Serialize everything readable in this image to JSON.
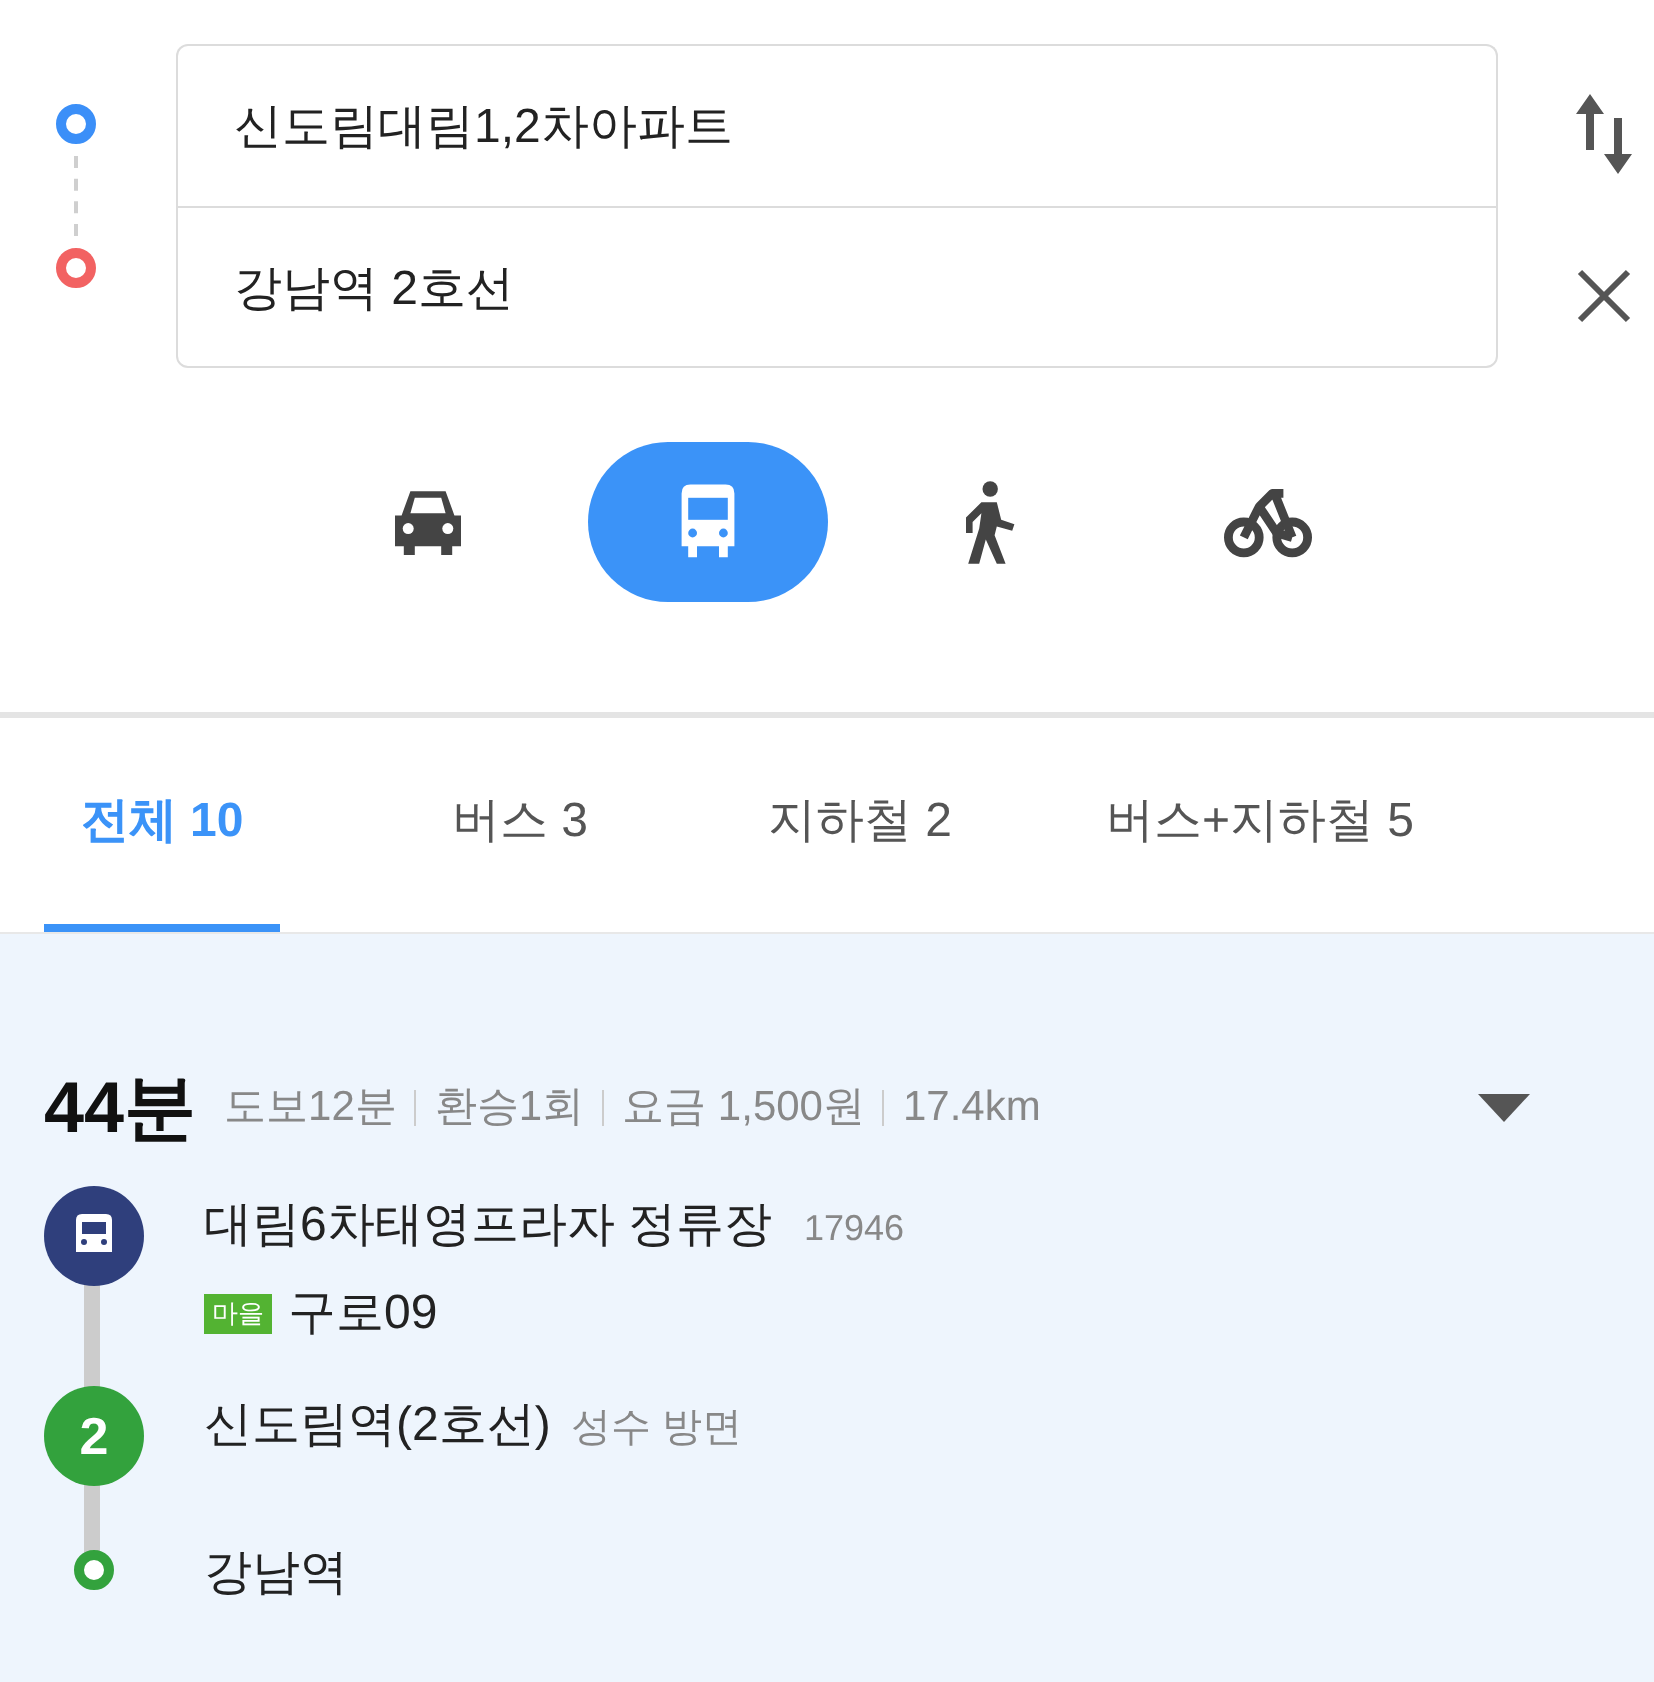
{
  "route_inputs": [
    {
      "kind": "origin",
      "value": "신도림대림1,2차아파트"
    },
    {
      "kind": "destination",
      "value": "강남역 2호선"
    }
  ],
  "modes": [
    {
      "kind": "car",
      "selected": false
    },
    {
      "kind": "bus",
      "selected": true
    },
    {
      "kind": "walk",
      "selected": false
    },
    {
      "kind": "bike",
      "selected": false
    }
  ],
  "tabs": [
    {
      "label": "전체 10",
      "selected": true
    },
    {
      "label": "버스 3",
      "selected": false
    },
    {
      "label": "지하철 2",
      "selected": false
    },
    {
      "label": "버스+지하철 5",
      "selected": false
    }
  ],
  "route": {
    "duration": "44분",
    "details": [
      "도보12분",
      "환승1회",
      "요금 1,500원",
      "17.4km"
    ],
    "steps": [
      {
        "kind": "bus",
        "name": "대림6차태영프라자 정류장",
        "code": "17946",
        "badge": "마을",
        "line": "구로09"
      },
      {
        "kind": "subway",
        "icon_label": "2",
        "name": "신도림역(2호선)",
        "direction": "성수 방면"
      },
      {
        "kind": "end",
        "name": "강남역"
      }
    ]
  }
}
